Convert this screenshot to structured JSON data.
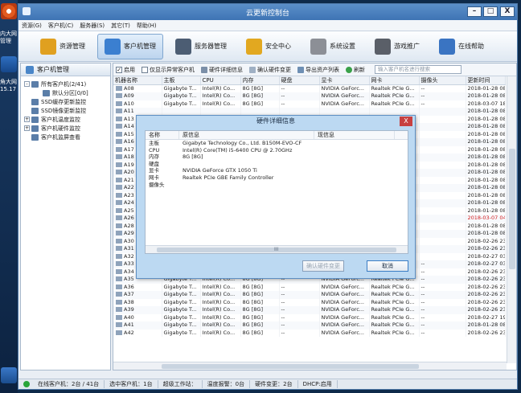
{
  "desktop": {
    "labels": [
      "内大网",
      "管理",
      "角大网",
      "15.17"
    ]
  },
  "window": {
    "title": "云更新控制台",
    "buttons": {
      "min": "–",
      "max": "□",
      "close": "X"
    }
  },
  "menu": [
    "资源(G)",
    "客户机(C)",
    "服务器(S)",
    "其它(T)",
    "帮助(H)"
  ],
  "toolbar": [
    {
      "label": "资源管理",
      "icon": "resource-icon",
      "color": "#e0a020"
    },
    {
      "label": "客户机管理",
      "icon": "client-monitor-icon",
      "color": "#3b7fd0"
    },
    {
      "label": "服务器管理",
      "icon": "server-icon",
      "color": "#4c5d73"
    },
    {
      "label": "安全中心",
      "icon": "shield-icon",
      "color": "#e2a820"
    },
    {
      "label": "系统设置",
      "icon": "gear-icon",
      "color": "#8c8f96"
    },
    {
      "label": "游戏推广",
      "icon": "gamepad-icon",
      "color": "#5a5f68"
    },
    {
      "label": "在线帮助",
      "icon": "help-person-icon",
      "color": "#3a74c2"
    }
  ],
  "sidebar": {
    "header": "客户机管理",
    "tree": [
      {
        "label": "所有客户机(2/41)",
        "level": 0,
        "exp": "-"
      },
      {
        "label": "默认分区[0/0]",
        "level": 2,
        "exp": ""
      },
      {
        "label": "SSD缓存更新监控",
        "level": 0,
        "exp": ""
      },
      {
        "label": "SSD镜像更新监控",
        "level": 0,
        "exp": ""
      },
      {
        "label": "客户机温度监控",
        "level": 0,
        "exp": "+"
      },
      {
        "label": "客户机硬件监控",
        "level": 0,
        "exp": "+"
      },
      {
        "label": "客户机监屏查看",
        "level": 0,
        "exp": ""
      }
    ]
  },
  "filters": {
    "enable": "启用",
    "only_abnormal": "仅显示异常客户机",
    "hw_detail": "硬件详细信息",
    "confirm_hw": "确认硬件变更",
    "export": "导出资产列表",
    "refresh": "刷新",
    "search_placeholder": "输入客户机名进行搜索"
  },
  "table": {
    "columns": [
      "机器名称",
      "主板",
      "CPU",
      "内存",
      "硬盘",
      "显卡",
      "网卡",
      "摄像头",
      "更新时间"
    ],
    "rows": [
      [
        "A08",
        "Gigabyte T...",
        "Intel(R) Co...",
        "8G [8G]",
        "--",
        "NVIDIA GeForc...",
        "Realtek PCIe G...",
        "--",
        "2018-01-28 08:",
        false
      ],
      [
        "A09",
        "Gigabyte T...",
        "Intel(R) Co...",
        "8G [8G]",
        "--",
        "NVIDIA GeForc...",
        "Realtek PCIe G...",
        "--",
        "2018-01-28 08:",
        false
      ],
      [
        "A10",
        "Gigabyte T...",
        "Intel(R) Co...",
        "8G [8G]",
        "--",
        "NVIDIA GeForc...",
        "Realtek PCIe G...",
        "--",
        "2018-03-07 18:",
        false
      ],
      [
        "A11",
        "",
        "",
        "",
        "",
        "",
        "",
        "",
        "2018-01-28 08:",
        false
      ],
      [
        "A13",
        "",
        "",
        "",
        "",
        "",
        "",
        "",
        "2018-01-28 08:",
        false
      ],
      [
        "A14",
        "",
        "",
        "",
        "",
        "",
        "",
        "",
        "2018-01-28 08:",
        false
      ],
      [
        "A15",
        "",
        "",
        "",
        "",
        "",
        "",
        "",
        "2018-01-28 08:",
        false
      ],
      [
        "A16",
        "",
        "",
        "",
        "",
        "",
        "",
        "",
        "2018-01-28 08:",
        false
      ],
      [
        "A17",
        "",
        "",
        "",
        "",
        "",
        "",
        "",
        "2018-01-28 08:",
        false
      ],
      [
        "A18",
        "",
        "",
        "",
        "",
        "",
        "",
        "",
        "2018-01-28 08:",
        false
      ],
      [
        "A19",
        "",
        "",
        "",
        "",
        "",
        "",
        "",
        "2018-01-28 08:",
        false
      ],
      [
        "A20",
        "",
        "",
        "",
        "",
        "",
        "",
        "",
        "2018-01-28 08:",
        false
      ],
      [
        "A21",
        "",
        "",
        "",
        "",
        "",
        "",
        "",
        "2018-01-28 08:",
        false
      ],
      [
        "A22",
        "",
        "",
        "",
        "",
        "",
        "",
        "",
        "2018-01-28 08:",
        false
      ],
      [
        "A23",
        "",
        "",
        "",
        "",
        "",
        "",
        "",
        "2018-01-28 08:",
        false
      ],
      [
        "A24",
        "",
        "",
        "",
        "",
        "",
        "",
        "",
        "2018-01-28 08:",
        false
      ],
      [
        "A25",
        "",
        "",
        "",
        "",
        "",
        "",
        "",
        "2018-01-28 08:",
        false
      ],
      [
        "A26",
        "",
        "",
        "",
        "",
        "",
        "",
        "",
        "2018-03-07 04:",
        true
      ],
      [
        "A28",
        "",
        "",
        "",
        "",
        "",
        "",
        "",
        "2018-01-28 08:",
        false
      ],
      [
        "A29",
        "",
        "",
        "",
        "",
        "",
        "",
        "",
        "2018-01-28 08:",
        false
      ],
      [
        "A30",
        "",
        "",
        "",
        "",
        "",
        "",
        "",
        "2018-02-26 23:",
        false
      ],
      [
        "A31",
        "",
        "",
        "",
        "",
        "",
        "",
        "",
        "2018-02-26 23:",
        false
      ],
      [
        "A32",
        "",
        "",
        "",
        "",
        "",
        "",
        "",
        "2018-02-27 03:",
        false
      ],
      [
        "A33",
        "Gigabyte T...",
        "Intel(R) Co...",
        "8G [8G]",
        "--",
        "NVIDIA GeForc...",
        "Realtek PCIe G...",
        "--",
        "2018-02-27 03:",
        false
      ],
      [
        "A34",
        "Gigabyte T...",
        "Intel(R) Co...",
        "8G [8G]",
        "--",
        "NVIDIA GeForc...",
        "Realtek PCIe G...",
        "--",
        "2018-02-26 23:",
        false
      ],
      [
        "A35",
        "Gigabyte T...",
        "Intel(R) Co...",
        "8G [8G]",
        "--",
        "NVIDIA GeForc...",
        "Realtek PCIe G...",
        "--",
        "2018-02-26 23:",
        false
      ],
      [
        "A36",
        "Gigabyte T...",
        "Intel(R) Co...",
        "8G [8G]",
        "--",
        "NVIDIA GeForc...",
        "Realtek PCIe G...",
        "--",
        "2018-02-26 23:",
        false
      ],
      [
        "A37",
        "Gigabyte T...",
        "Intel(R) Co...",
        "8G [8G]",
        "--",
        "NVIDIA GeForc...",
        "Realtek PCIe G...",
        "--",
        "2018-02-26 23:",
        false
      ],
      [
        "A38",
        "Gigabyte T...",
        "Intel(R) Co...",
        "8G [8G]",
        "--",
        "NVIDIA GeForc...",
        "Realtek PCIe G...",
        "--",
        "2018-02-26 23:",
        false
      ],
      [
        "A39",
        "Gigabyte T...",
        "Intel(R) Co...",
        "8G [8G]",
        "--",
        "NVIDIA GeForc...",
        "Realtek PCIe G...",
        "--",
        "2018-02-26 23:",
        false
      ],
      [
        "A40",
        "Gigabyte T...",
        "Intel(R) Co...",
        "8G [8G]",
        "--",
        "NVIDIA GeForc...",
        "Realtek PCIe G...",
        "--",
        "2018-02-27 19:",
        false
      ],
      [
        "A41",
        "Gigabyte T...",
        "Intel(R) Co...",
        "8G [8G]",
        "--",
        "NVIDIA GeForc...",
        "Realtek PCIe G...",
        "--",
        "2018-01-28 08:",
        false
      ],
      [
        "A42",
        "Gigabyte T...",
        "Intel(R) Co...",
        "8G [8G]",
        "--",
        "NVIDIA GeForc...",
        "Realtek PCIe G...",
        "--",
        "2018-02-26 23:",
        false
      ]
    ]
  },
  "status": {
    "online": "在线客户机：2台 / 41台",
    "selected": "选中客户机：1台",
    "super": "超级工作站：",
    "temp": "温度报警：0台",
    "hw_change": "硬件变更：2台",
    "dhcp": "DHCP:启用"
  },
  "dialog": {
    "title": "硬件详细信息",
    "close": "X",
    "columns": [
      "名称",
      "原信息",
      "现信息"
    ],
    "rows": [
      [
        "主板",
        "Gigabyte Technology Co., Ltd. B150M-EVO-CF",
        ""
      ],
      [
        "CPU",
        "Intel(R) Core(TM) i5-6400 CPU @ 2.70GHz",
        ""
      ],
      [
        "内存",
        "8G [8G]",
        ""
      ],
      [
        "硬盘",
        "",
        ""
      ],
      [
        "显卡",
        "NVIDIA GeForce GTX 1050 Ti",
        ""
      ],
      [
        "网卡",
        "Realtek PCIe GBE Family Controller",
        ""
      ],
      [
        "摄像头",
        "",
        ""
      ]
    ],
    "scroll_mark": "III",
    "confirm_button": "确认硬件变更",
    "cancel_button": "取消"
  }
}
